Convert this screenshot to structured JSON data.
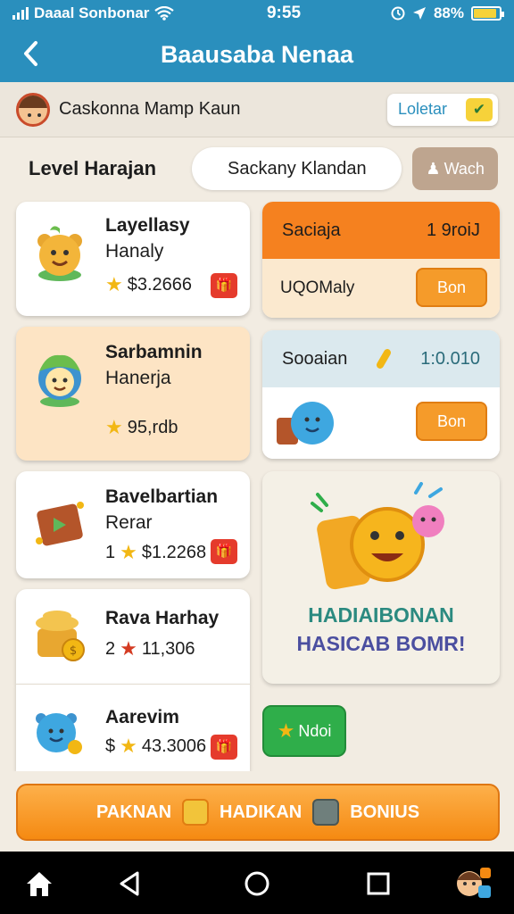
{
  "status_bar": {
    "carrier": "Daaal Sonbonar",
    "time": "9:55",
    "battery": "88%",
    "battery_level": 0.88
  },
  "header": {
    "title": "Baausaba Nenaa",
    "back_icon": "chevron-left-icon"
  },
  "account": {
    "name": "Caskonna Mamp Kaun",
    "lottery_label": "Loletar"
  },
  "level_row": {
    "label": "Level Harajan",
    "search_placeholder": "Sackany Klandan",
    "watch_label": "Wach"
  },
  "left_cards": [
    {
      "title": "Layellasy",
      "subtitle": "Hanaly",
      "price_prefix": "",
      "price": "$3.2666"
    },
    {
      "title": "Sarbamnin",
      "subtitle": "Hanerja",
      "price_prefix": "",
      "price": "95,rdb"
    },
    {
      "title": "Bavelbartian",
      "subtitle": "Rerar",
      "price_prefix": "1",
      "price": "$1.2268"
    },
    {
      "title": "Rava Harhay",
      "subtitle": "",
      "price_prefix": "2",
      "price": "11,306"
    },
    {
      "title": "Aarevim",
      "subtitle": "",
      "price_prefix": "$",
      "price": "43.3006"
    }
  ],
  "promo_cards": [
    {
      "label": "Saciaja",
      "value": "1 9roiJ",
      "body_label": "UQOMaly",
      "button": "Bon"
    },
    {
      "label": "Sooaian",
      "value": "1:0.010",
      "body_label": "",
      "button": "Bon"
    }
  ],
  "banner": {
    "line1": "HADIAIBONAN",
    "line2": "HASICAB BOMR!"
  },
  "new_button": "Ndoi",
  "bonus_bar": {
    "part1": "PAKNAN",
    "part2": "HADIKAN",
    "part3": "BONIUS"
  },
  "colors": {
    "primary": "#2a8fbd",
    "accent_orange": "#f58a12",
    "green": "#2fae4a"
  }
}
